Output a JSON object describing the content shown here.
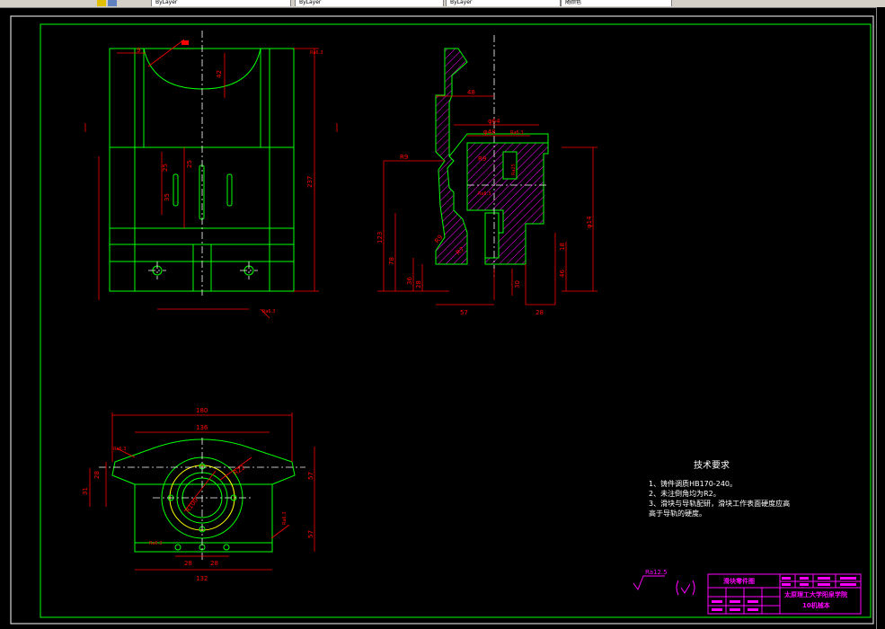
{
  "toolbar": {
    "tabs": [
      "ByLayer",
      "ByLayer",
      "ByLayer",
      "随颜色"
    ]
  },
  "dims_front": [
    "9",
    "42",
    "Ra6.3",
    "237",
    "25",
    "25",
    "35",
    "Ra6.3"
  ],
  "dims_side": [
    "48",
    "φ64",
    "φ48",
    "Ra6.3",
    "R9",
    "R9",
    "Ra25",
    "Ra6.3",
    "R9",
    "123",
    "78",
    "36",
    "28",
    "R7",
    "57",
    "28",
    "18",
    "46",
    "30",
    "φ14"
  ],
  "dims_top": [
    "180",
    "136",
    "Ra6.3",
    "28",
    "31",
    "57",
    "57",
    "Ra6.3",
    "R22",
    "R100",
    "Ra6.3",
    "28",
    "28",
    "132"
  ],
  "tech": {
    "title": "技术要求",
    "line1": "1、铸件调质HB170-240。",
    "line2": "2、未注倒角均为R2。",
    "line3a": "3、滑块与导轨配研，滑块工作表面硬度应高",
    "line3b": "高于导轨的硬度。"
  },
  "roughness": "Ra12.5",
  "titleblock": {
    "name": "滑块零件图",
    "school": "太原理工大学阳泉学院",
    "class": "10机械本"
  },
  "colors": {
    "frame": "#00ff00",
    "part": "#00ff00",
    "dim": "#ff0000",
    "center": "#ffffff",
    "hatch": "#ff00ff",
    "titleblock": "#ff00ff"
  }
}
